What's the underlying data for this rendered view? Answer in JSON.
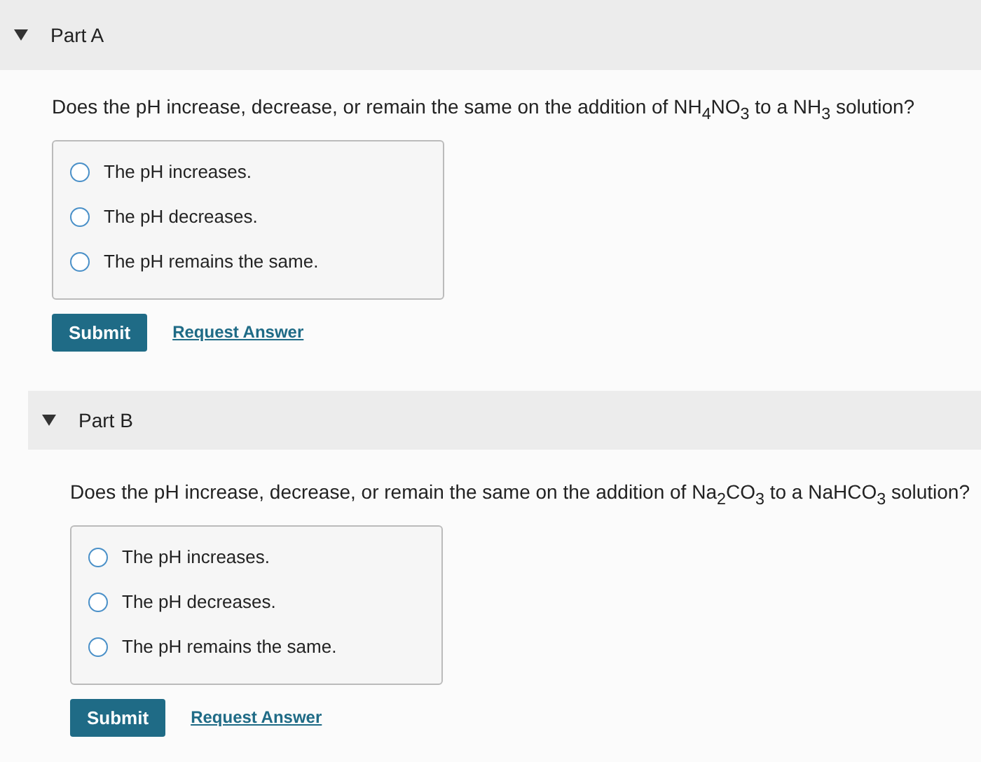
{
  "parts": [
    {
      "title": "Part A",
      "expanded": true,
      "question": "Does the pH increase, decrease, or remain the same on the addition of NH$_{4}$NO$_{3}$ to a NH$_{3}$ solution?",
      "options": [
        {
          "label": "The pH increases.",
          "selected": false
        },
        {
          "label": "The pH decreases.",
          "selected": false
        },
        {
          "label": "The pH remains the same.",
          "selected": false
        }
      ],
      "submit": "Submit",
      "request": "Request Answer"
    },
    {
      "title": "Part B",
      "expanded": true,
      "question": "Does the pH increase, decrease, or remain the same on the addition of Na$_{2}$CO$_{3}$ to a NaHCO$_{3}$ solution?",
      "options": [
        {
          "label": "The pH increases.",
          "selected": false
        },
        {
          "label": "The pH decreases.",
          "selected": false
        },
        {
          "label": "The pH remains the same.",
          "selected": false
        }
      ],
      "submit": "Submit",
      "request": "Request Answer"
    }
  ]
}
